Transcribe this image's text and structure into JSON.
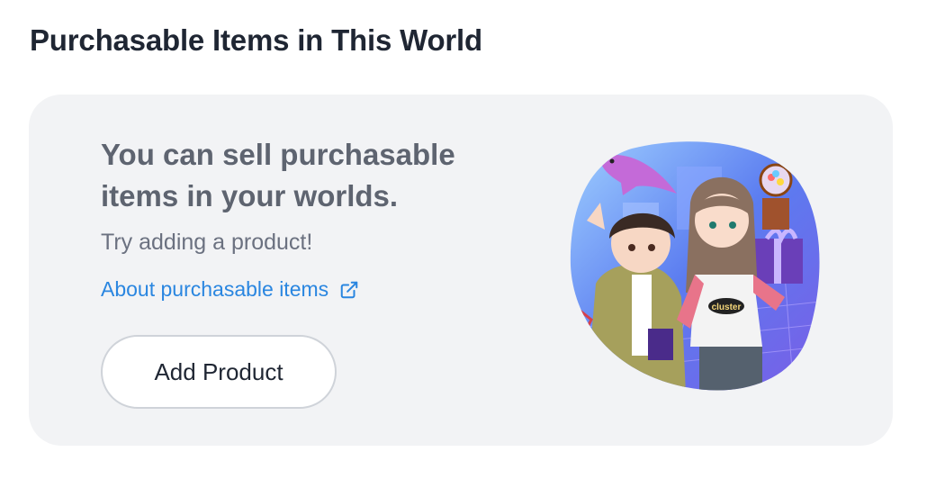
{
  "section": {
    "title": "Purchasable Items in This World"
  },
  "empty_state": {
    "headline": "You can sell purchasable items in your worlds.",
    "subtext": "Try adding a product!",
    "link_label": "About purchasable items",
    "link_icon": "external-link-icon",
    "button_label": "Add Product",
    "illustration": {
      "description_icon": "avatars-shopping-illustration",
      "shirt_logo_text": "cluster"
    }
  },
  "colors": {
    "card_background": "#f2f3f5",
    "link": "#2a86e0",
    "title": "#1f2633",
    "headline": "#5e6470"
  }
}
